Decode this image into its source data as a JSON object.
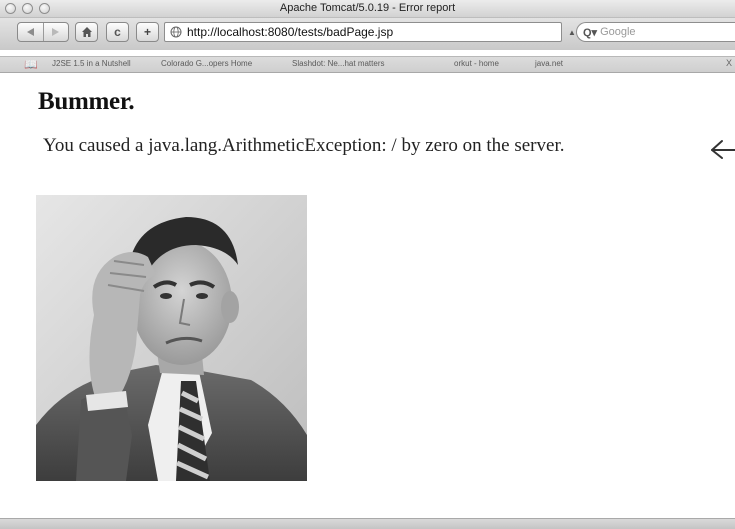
{
  "window": {
    "title": "Apache Tomcat/5.0.19 - Error report"
  },
  "toolbar": {
    "back_icon": "back-arrow-icon",
    "forward_icon": "forward-arrow-icon",
    "home_icon": "home-icon",
    "reload_label": "c",
    "add_label": "+",
    "url": "http://localhost:8080/tests/badPage.jsp",
    "search_glyph": "Q▾",
    "search_placeholder": "Google"
  },
  "bookmarks": {
    "items": [
      "J2SE 1.5 in a Nutshell",
      "Colorado G...opers Home",
      "Slashdot: Ne...hat matters",
      "orkut - home",
      "java.net"
    ],
    "close_label": "X"
  },
  "page": {
    "heading": "Bummer.",
    "message": "You caused a java.lang.ArithmeticException: / by zero on the server.",
    "image": "distressed-man-photo"
  },
  "colors": {
    "chrome_light": "#ececec",
    "chrome_dark": "#c9c9c9",
    "text": "#222222",
    "page_bg": "#ffffff"
  }
}
